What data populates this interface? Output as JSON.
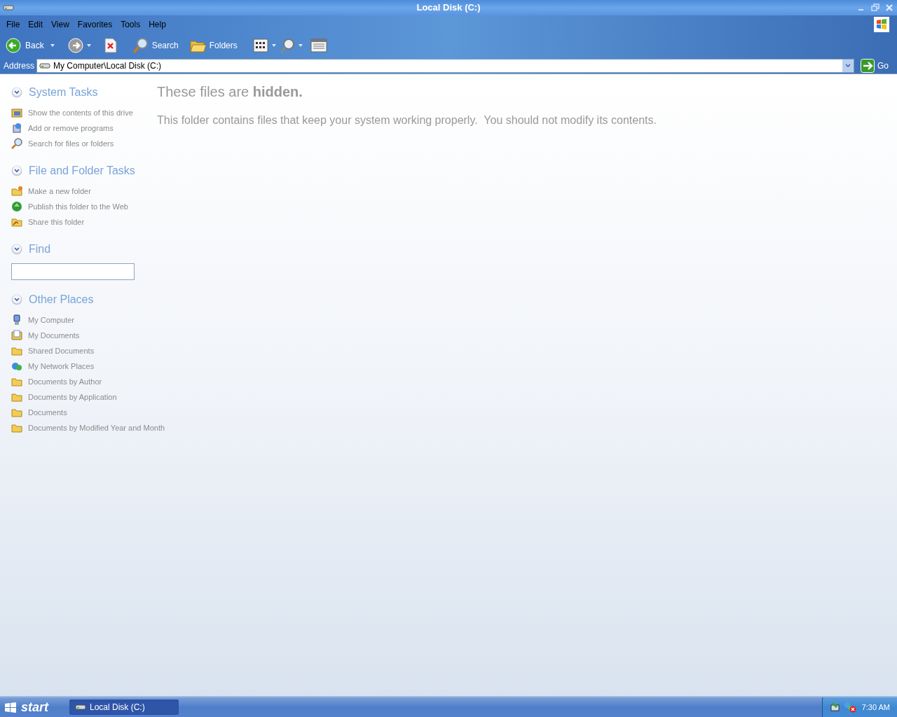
{
  "window": {
    "title": "Local Disk (C:)"
  },
  "menu": [
    "File",
    "Edit",
    "View",
    "Favorites",
    "Tools",
    "Help"
  ],
  "toolbar": {
    "back": "Back",
    "search": "Search",
    "folders": "Folders"
  },
  "address": {
    "label": "Address",
    "value": "My Computer\\Local Disk (C:)",
    "go": "Go"
  },
  "sidebar": [
    {
      "kind": "links",
      "title": "System Tasks",
      "items": [
        "Show the contents of this drive",
        "Add or remove programs",
        "Search for files or folders"
      ]
    },
    {
      "kind": "links",
      "title": "File and Folder Tasks",
      "items": [
        "Make a new folder",
        "Publish this folder to the Web",
        "Share this folder"
      ]
    },
    {
      "kind": "search",
      "title": "Find"
    },
    {
      "kind": "links",
      "title": "Other Places",
      "items": [
        "My Computer",
        "My Documents",
        "Shared Documents",
        "My Network Places",
        "Documents by Author",
        "Documents by Application",
        "Documents",
        "Documents by Modified Year and Month"
      ]
    }
  ],
  "content": {
    "heading": "These files are **hidden.**",
    "message": "This folder contains files that keep your system working properly.  You should not modify its contents."
  },
  "taskbar": {
    "start": "start",
    "tasks": [
      {
        "label": "Local Disk (C:)",
        "selected": true
      }
    ],
    "clock": "7:30 AM"
  }
}
